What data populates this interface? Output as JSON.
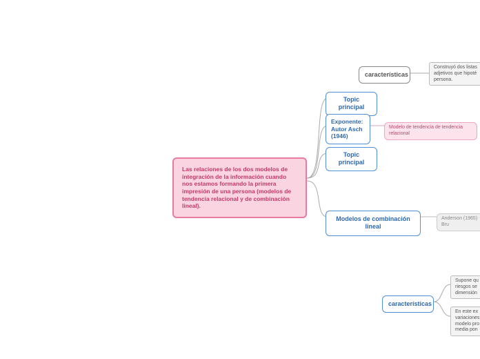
{
  "root": "Las relaciones de los dos modelos de integración de la información cuando nos estamos formando la primera impresión de una persona (modelos de tendencia relacional y de combinación lineal).",
  "nodes": {
    "caracteristicas1": "características",
    "construyo": "Construyó dos listas adjetivos que hipoté persona.",
    "topic1": "Topic principal",
    "exponente": "Exponente: Autor Asch (1946)",
    "modeloRelacional": "Modelo de tendencia de tendencia relacional",
    "topic2": "Topic principal",
    "combinacion": "Modelos de combinación lineal",
    "anderson": "Anderson (1965) Bru",
    "caracteristicas2": "características",
    "supone": "Supone qu riesgos se dimensión",
    "eneste": "En este ex variaciones modelo pro media pon"
  }
}
